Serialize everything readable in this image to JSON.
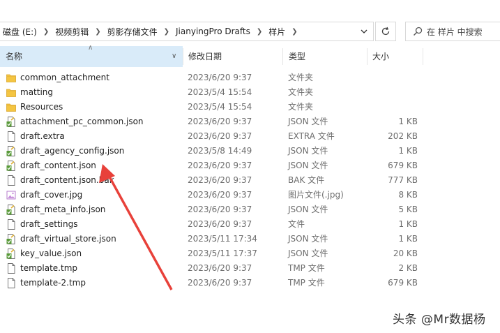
{
  "address_bar": {
    "breadcrumbs": [
      "磁盘 (E:)",
      "视频剪辑",
      "剪影存储文件",
      "JianyingPro Drafts",
      "样片"
    ]
  },
  "search": {
    "placeholder": "在 样片 中搜索"
  },
  "columns": {
    "name": "名称",
    "date": "修改日期",
    "type": "类型",
    "size": "大小"
  },
  "files": [
    {
      "name": "common_attachment",
      "date": "2023/6/20 9:37",
      "type": "文件夹",
      "size": "",
      "icon": "folder"
    },
    {
      "name": "matting",
      "date": "2023/5/4 15:54",
      "type": "文件夹",
      "size": "",
      "icon": "folder"
    },
    {
      "name": "Resources",
      "date": "2023/5/4 15:54",
      "type": "文件夹",
      "size": "",
      "icon": "folder"
    },
    {
      "name": "attachment_pc_common.json",
      "date": "2023/6/20 9:37",
      "type": "JSON 文件",
      "size": "1 KB",
      "icon": "json"
    },
    {
      "name": "draft.extra",
      "date": "2023/6/20 9:37",
      "type": "EXTRA 文件",
      "size": "202 KB",
      "icon": "file"
    },
    {
      "name": "draft_agency_config.json",
      "date": "2023/5/8 14:49",
      "type": "JSON 文件",
      "size": "1 KB",
      "icon": "json"
    },
    {
      "name": "draft_content.json",
      "date": "2023/6/20 9:37",
      "type": "JSON 文件",
      "size": "679 KB",
      "icon": "json"
    },
    {
      "name": "draft_content.json.bak",
      "date": "2023/6/20 9:37",
      "type": "BAK 文件",
      "size": "777 KB",
      "icon": "file"
    },
    {
      "name": "draft_cover.jpg",
      "date": "2023/6/20 9:37",
      "type": "图片文件(.jpg)",
      "size": "8 KB",
      "icon": "image"
    },
    {
      "name": "draft_meta_info.json",
      "date": "2023/6/20 9:37",
      "type": "JSON 文件",
      "size": "5 KB",
      "icon": "json"
    },
    {
      "name": "draft_settings",
      "date": "2023/6/20 9:37",
      "type": "文件",
      "size": "1 KB",
      "icon": "file"
    },
    {
      "name": "draft_virtual_store.json",
      "date": "2023/5/11 17:34",
      "type": "JSON 文件",
      "size": "1 KB",
      "icon": "json"
    },
    {
      "name": "key_value.json",
      "date": "2023/5/11 17:37",
      "type": "JSON 文件",
      "size": "20 KB",
      "icon": "json"
    },
    {
      "name": "template.tmp",
      "date": "2023/6/20 9:37",
      "type": "TMP 文件",
      "size": "2 KB",
      "icon": "file"
    },
    {
      "name": "template-2.tmp",
      "date": "2023/6/20 9:37",
      "type": "TMP 文件",
      "size": "679 KB",
      "icon": "file"
    }
  ],
  "annotation": {
    "color": "#e8413a"
  },
  "watermark": "头条 @Mr数据杨",
  "colors": {
    "header_selected": "#d9ebf9",
    "folder": "#f4c542",
    "json_badge": "#5a9b3a"
  }
}
